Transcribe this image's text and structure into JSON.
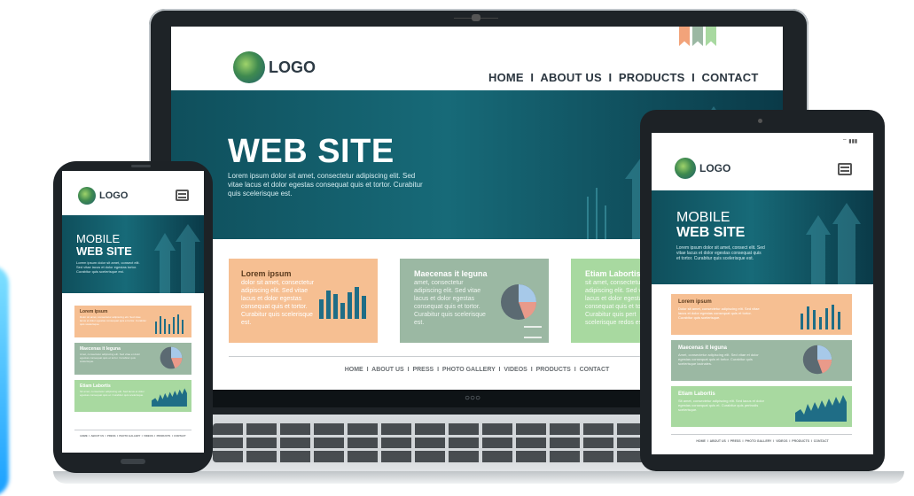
{
  "laptop": {
    "logo": "LOGO",
    "nav": "HOME  I  ABOUT US  I  PRODUCTS  I  CONTACT",
    "hero_title": "WEB SITE",
    "hero_text": "Lorem ipsum dolor sit amet, consectetur adipiscing elit. Sed vitae lacus et dolor egestas consequat quis et tortor. Curabitur quis scelerisque est.",
    "cards": [
      {
        "title": "Lorem ipsum",
        "text": "dolor sit amet, consectetur adipiscing elit. Sed vitae lacus et dolor egestas consequat quis et tortor. Curabitur quis scelerisque est.",
        "color": "#f6bf92"
      },
      {
        "title": "Maecenas it leguna",
        "text": "amet, consectetur adipiscing elit. Sed vitae lacus et dolor egestas consequat quis et tortor. Curabitur quis scelerisque est.",
        "color": "#9bb8a3"
      },
      {
        "title": "Etiam Labortis",
        "text": "sit amet, consectetur adipiscing elit. Sed vitae lacus et dolor egestas consequat quis et tortor. Curabitur quis pert scelerisque redos est.",
        "color": "#a8d9a0"
      }
    ],
    "footer_nav": "HOME  I  ABOUT US  I  PRESS  I  PHOTO GALLERY  I  VIDEOS  I  PRODUCTS  I  CONTACT"
  },
  "tablet": {
    "logo": "LOGO",
    "hero_line1": "MOBILE",
    "hero_line2": "WEB SITE",
    "hero_text": "Lorem ipsum dolor sit amet, consect elit. Sed vitae lacus et dolor egestas consequat quis et tortor. Curabitur quis scelerisque est.",
    "cards": [
      {
        "title": "Lorem ipsum",
        "text": "Dolor sit amet, consectetur adipiscing elit. Sed vitae lacus et dolor egestas consequat quis et tortor. Curabitur quis scelerisque.",
        "color": "#f6bf92"
      },
      {
        "title": "Maecenas it leguna",
        "text": "Amet, consectetur adipiscing elit. Sed vitae et dolor egestas consequat quis et tortor. Curabitur quis scelerisque lacinales.",
        "color": "#9bb8a3"
      },
      {
        "title": "Etiam Labortis",
        "text": "Sit amet, consectetur adipiscing elit. Sed lacus et dolor egestas consequat quis et. Curabitur quis pertrodis scelerisque.",
        "color": "#a8d9a0"
      }
    ],
    "footer_nav": "HOME  I  ABOUT US  I  PRESS  I  PHOTO GALLERY  I  VIDEOS  I  PRODUCTS  I  CONTACT"
  },
  "phone": {
    "logo": "LOGO",
    "hero_line1": "MOBILE",
    "hero_line2": "WEB SITE",
    "hero_text": "Lorem ipsum dolor sit amet, consect elit. Sed vitae lacus et dolor egestas tortor. Curabitur quis scelerisque est.",
    "cards": [
      {
        "title": "Lorem ipsum",
        "text": "Dolor sit amet, consectetur adipiscing elit. Sed vitae lacus et dolor egestas consequat quis et tortor. Curabitur quis scelerisque.",
        "color": "#f6bf92"
      },
      {
        "title": "Maecenas it leguna",
        "text": "Amet, consectetur adipiscing elit. Sed vitae et dolor egestas consequat quis et tortor. Curabitur quis scelerisque.",
        "color": "#9bb8a3"
      },
      {
        "title": "Etiam Labortis",
        "text": "Sit amet, consectetur adipiscing elit. Sed lacus et dolor egestas consequat quis et. Curabitur quis scelerisque.",
        "color": "#a8d9a0"
      }
    ],
    "footer_nav": "HOME  I  ABOUT US  I  PRESS  I  PHOTO GALLERY  I  VIDEOS  I  PRODUCTS  I  CONTACT"
  },
  "colors": {
    "hero_dark": "#0f4f5c",
    "hero_light": "#176a78",
    "bar": "#1f6d86",
    "ribbon1": "#f2a37a",
    "ribbon2": "#9bb8a3",
    "ribbon3": "#a8d9a0"
  }
}
